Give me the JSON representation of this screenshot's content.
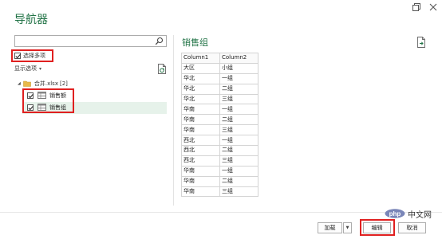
{
  "dialog": {
    "title": "导航器"
  },
  "left_panel": {
    "search": {
      "value": "",
      "placeholder": ""
    },
    "select_multiple_label": "选择多项",
    "select_multiple_checked": true,
    "display_options_label": "显示选项",
    "tree": {
      "root_label": "合并.xlsx",
      "root_count": "[2]",
      "items": [
        {
          "label": "销售额",
          "checked": true,
          "selected": false
        },
        {
          "label": "销售组",
          "checked": true,
          "selected": true
        }
      ]
    }
  },
  "preview": {
    "title": "销售组",
    "columns": [
      "Column1",
      "Column2"
    ],
    "rows": [
      [
        "大区",
        "小组"
      ],
      [
        "华北",
        "一组"
      ],
      [
        "华北",
        "二组"
      ],
      [
        "华北",
        "三组"
      ],
      [
        "华南",
        "一组"
      ],
      [
        "华南",
        "二组"
      ],
      [
        "华南",
        "三组"
      ],
      [
        "西北",
        "一组"
      ],
      [
        "西北",
        "二组"
      ],
      [
        "西北",
        "三组"
      ],
      [
        "华南",
        "一组"
      ],
      [
        "华南",
        "二组"
      ],
      [
        "华南",
        "三组"
      ]
    ]
  },
  "footer": {
    "load_label": "加载",
    "edit_label": "编辑",
    "cancel_label": "取消"
  },
  "watermark": {
    "logo_text": "php",
    "text": "中文网"
  },
  "colors": {
    "accent_green": "#217346",
    "highlight_red": "#e02020",
    "selection_bg": "#e6f2ea"
  },
  "icons": {
    "search": "search-icon",
    "refresh": "refresh-icon",
    "export": "export-icon",
    "folder": "folder-icon",
    "table": "table-icon",
    "restore": "restore-icon",
    "close": "close-icon"
  }
}
